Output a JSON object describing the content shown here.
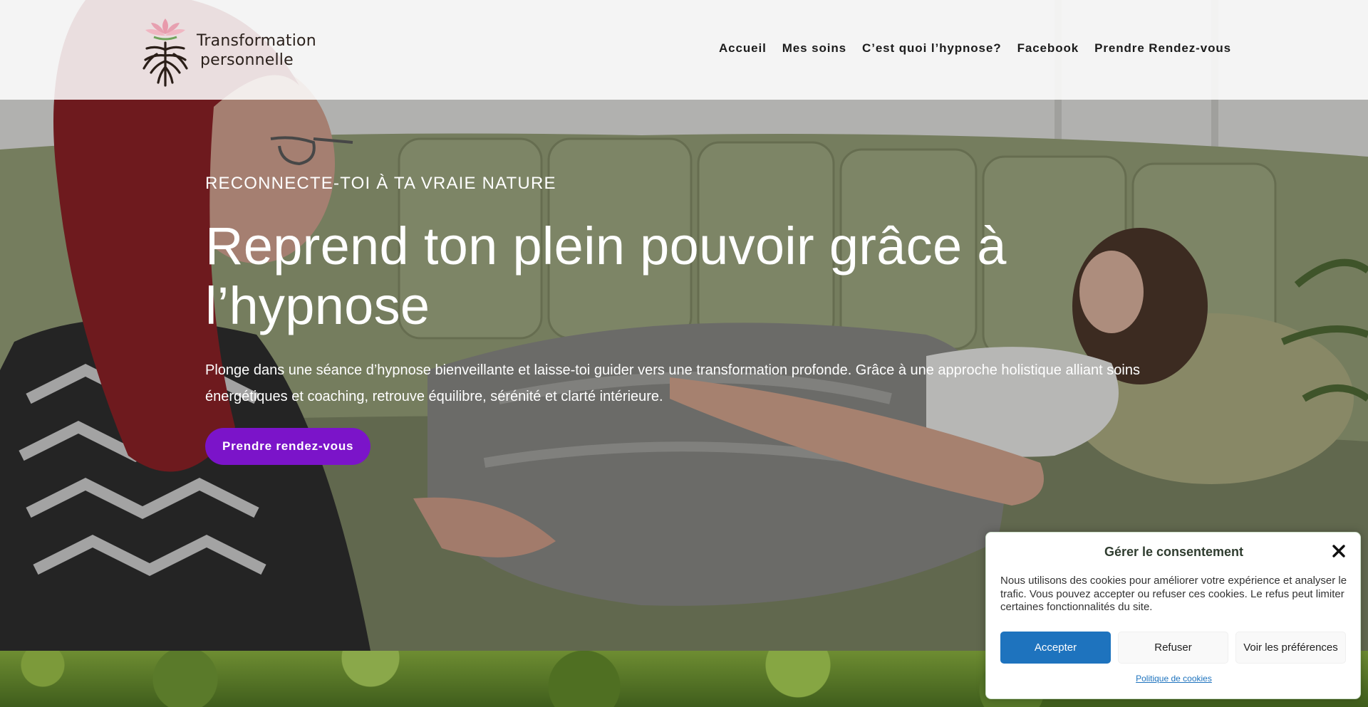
{
  "site": {
    "logo_line1": "Transformation",
    "logo_line2": "personnelle"
  },
  "nav": {
    "items": [
      {
        "label": "Accueil"
      },
      {
        "label": "Mes soins"
      },
      {
        "label": "C’est quoi l’hypnose?"
      },
      {
        "label": "Facebook"
      },
      {
        "label": "Prendre Rendez-vous"
      }
    ]
  },
  "hero": {
    "eyebrow": "RECONNECTE-TOI À TA VRAIE NATURE",
    "headline": "Reprend ton plein pouvoir grâce à l’hypnose",
    "lead": "Plonge dans une séance d’hypnose bienveillante et laisse-toi guider vers une transformation profonde. Grâce à une approche holistique alliant soins énergétiques et coaching, retrouve équilibre, sérénité et clarté intérieure.",
    "cta_label": "Prendre rendez-vous"
  },
  "consent": {
    "title": "Gérer le consentement",
    "text": "Nous utilisons des cookies pour améliorer votre expérience et analyser le trafic. Vous pouvez accepter ou refuser ces cookies. Le refus peut limiter certaines fonctionnalités du site.",
    "accept_label": "Accepter",
    "deny_label": "Refuser",
    "prefs_label": "Voir les préférences",
    "policy_link": "Politique de cookies"
  },
  "colors": {
    "accent_purple": "#7b14c9",
    "accept_blue": "#1e73be",
    "consent_title": "#2f3c2f"
  },
  "icons": {
    "logo": "lotus-tree-roots-logo",
    "close": "close-icon"
  }
}
